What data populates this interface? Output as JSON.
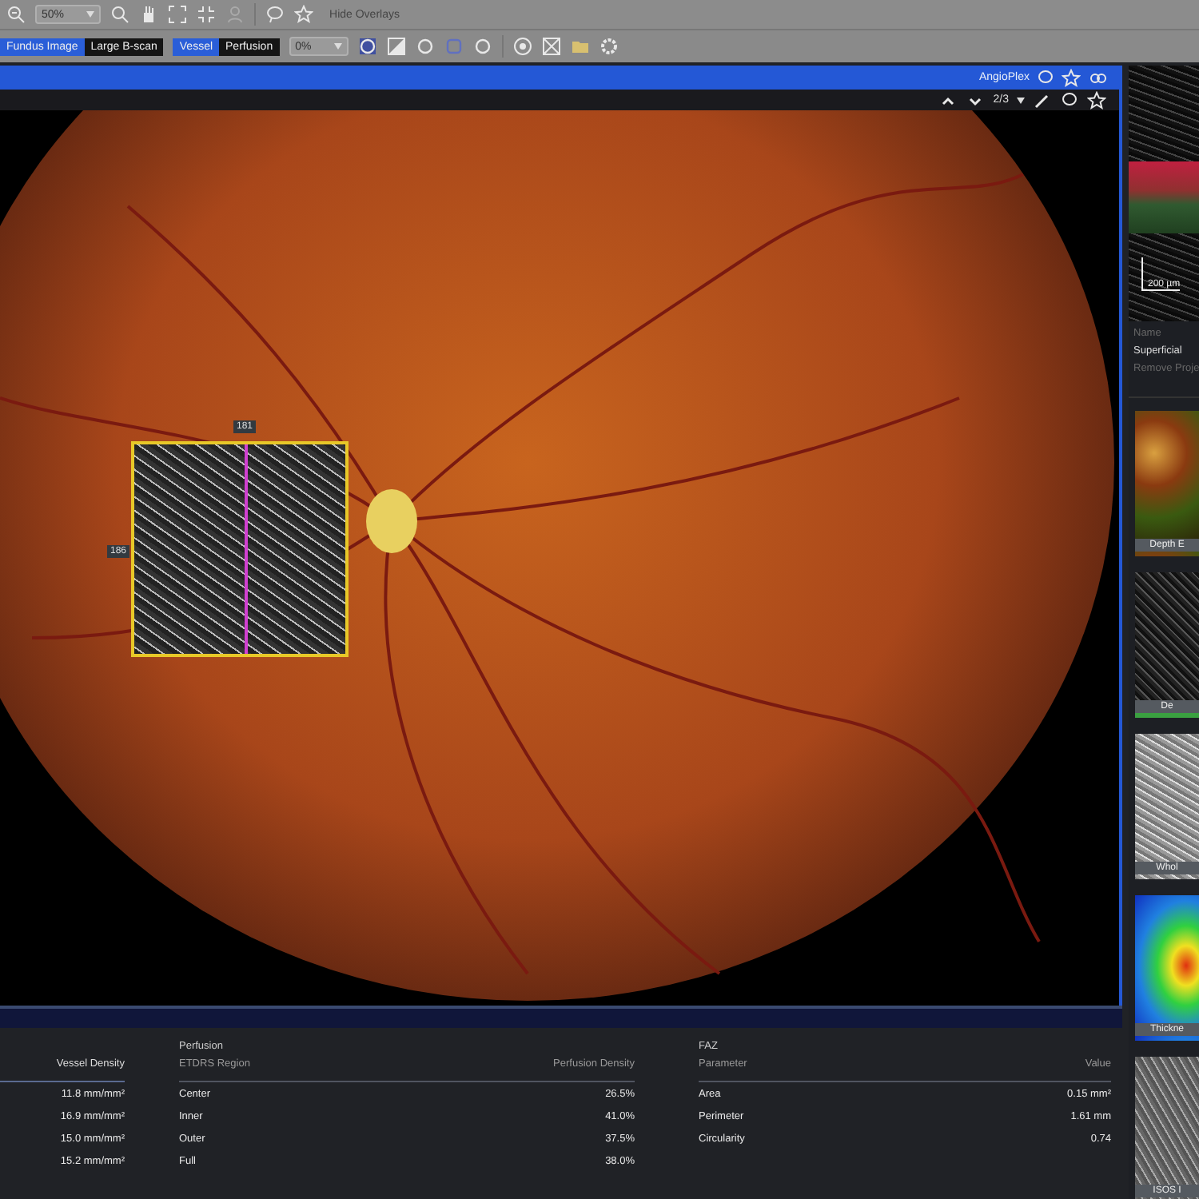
{
  "toolbar": {
    "zoom": "50%",
    "hide_overlays": "Hide Overlays",
    "opacity": "0%",
    "image_toggle": [
      {
        "label": "Fundus Image",
        "selected": true
      },
      {
        "label": "Large B-scan",
        "selected": false
      }
    ],
    "layer_toggle": [
      {
        "label": "Vessel",
        "selected": true
      },
      {
        "label": "Perfusion",
        "selected": false
      }
    ]
  },
  "viewer": {
    "app_label": "AngioPlex",
    "page": "2/3",
    "overlay_labels": [
      "181",
      "186"
    ]
  },
  "side_panel": {
    "scale": "200 µm",
    "name_label": "Name",
    "name_value": "Superficial",
    "remove_projection": "Remove Proje",
    "thumbnails": [
      {
        "label": "Depth E",
        "kind": "color-depth",
        "selected": false
      },
      {
        "label": "De",
        "kind": "dark-gray",
        "selected": true
      },
      {
        "label": "Whol",
        "kind": "light-gray",
        "selected": false
      },
      {
        "label": "Thickne",
        "kind": "thickness",
        "selected": false
      },
      {
        "label": "ISOS I",
        "kind": "mid-gray",
        "selected": false
      }
    ]
  },
  "vessel_density": {
    "header": "Vessel Density",
    "rows": [
      "11.8 mm/mm²",
      "16.9 mm/mm²",
      "15.0 mm/mm²",
      "15.2 mm/mm²"
    ]
  },
  "perfusion": {
    "title": "Perfusion",
    "columns": [
      "ETDRS Region",
      "Perfusion Density"
    ],
    "rows": [
      {
        "region": "Center",
        "value": "26.5%"
      },
      {
        "region": "Inner",
        "value": "41.0%"
      },
      {
        "region": "Outer",
        "value": "37.5%"
      },
      {
        "region": "Full",
        "value": "38.0%"
      }
    ]
  },
  "faz": {
    "title": "FAZ",
    "columns": [
      "Parameter",
      "Value"
    ],
    "rows": [
      {
        "parameter": "Area",
        "value": "0.15 mm²"
      },
      {
        "parameter": "Perimeter",
        "value": "1.61 mm"
      },
      {
        "parameter": "Circularity",
        "value": "0.74"
      }
    ]
  }
}
